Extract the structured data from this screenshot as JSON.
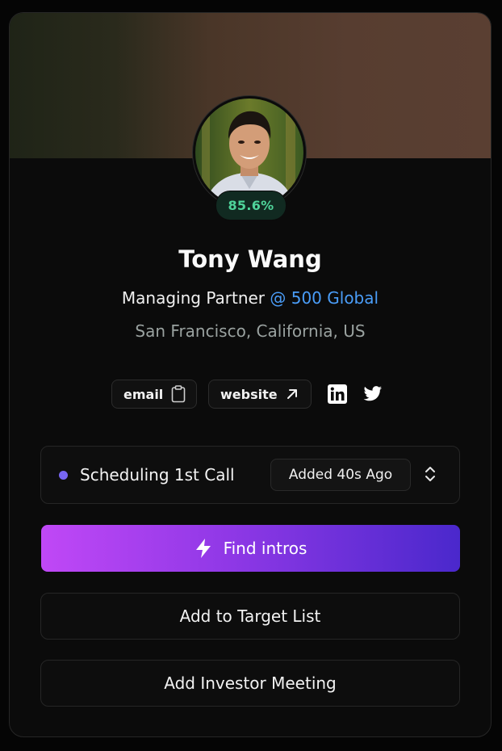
{
  "profile": {
    "name": "Tony Wang",
    "score": "85.6%",
    "title": "Managing Partner",
    "at": "@",
    "company": "500 Global",
    "location": "San Francisco, California, US"
  },
  "links": {
    "email_label": "email",
    "website_label": "website",
    "icons": [
      "clipboard-icon",
      "arrow-up-right-icon",
      "linkedin-icon",
      "twitter-icon"
    ]
  },
  "status": {
    "label": "Scheduling 1st Call",
    "added": "Added 40s Ago",
    "dot_color": "#7766f2"
  },
  "actions": {
    "find_intros": "Find intros",
    "add_target": "Add to Target List",
    "add_meeting": "Add Investor Meeting"
  },
  "colors": {
    "accent_link": "#4a9df8",
    "score_text": "#4fd39a",
    "primary_gradient_start": "#c048f6",
    "primary_gradient_end": "#4a28cc"
  }
}
